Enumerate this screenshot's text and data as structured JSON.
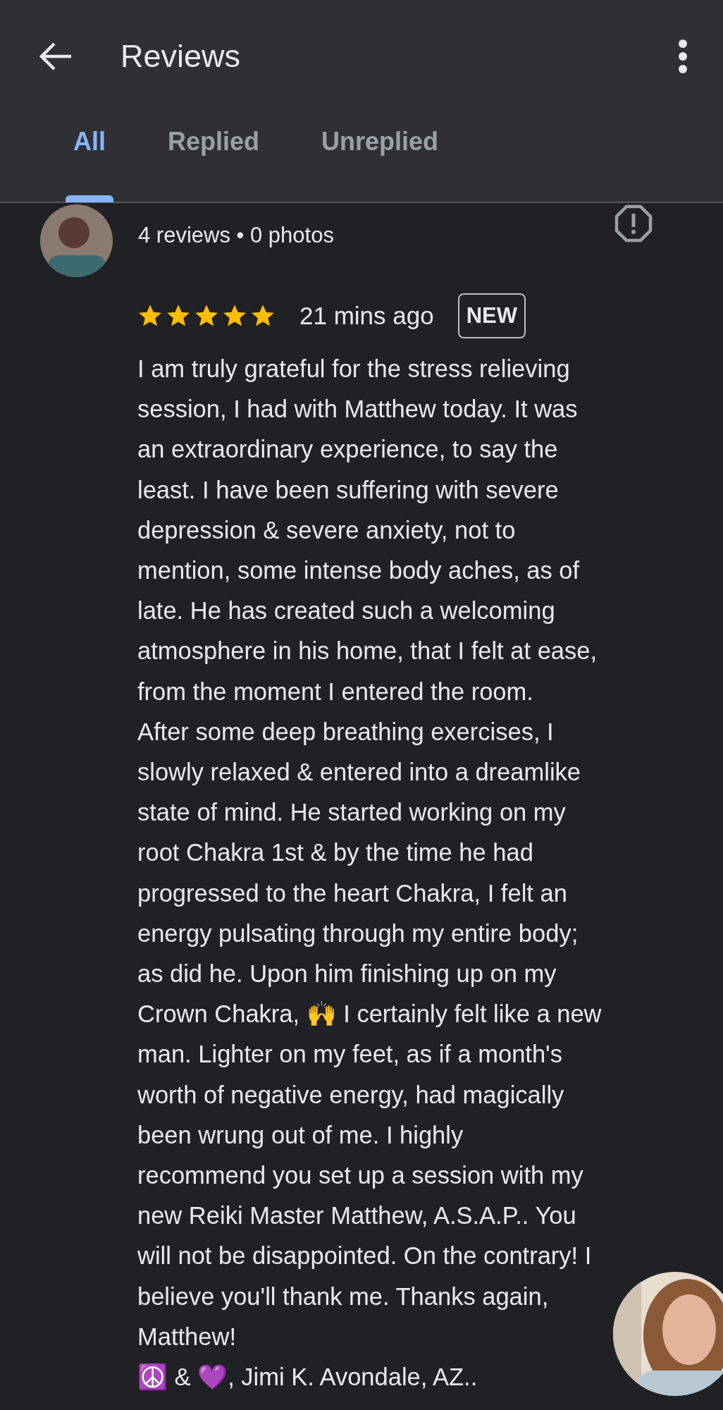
{
  "header": {
    "title": "Reviews"
  },
  "tabs": [
    {
      "label": "All",
      "selected": true
    },
    {
      "label": "Replied",
      "selected": false
    },
    {
      "label": "Unreplied",
      "selected": false
    }
  ],
  "review": {
    "meta": "4 reviews • 0 photos",
    "stars": 5,
    "time": "21 mins ago",
    "badge": "NEW",
    "text": "I am truly grateful for the stress relieving\nsession, I had with Matthew today. It was\nan extraordinary experience, to say the\nleast. I have been suffering with severe\ndepression & severe anxiety, not to\nmention, some intense body aches, as of\nlate. He has created such a welcoming\natmosphere in his home, that I felt at ease,\nfrom the moment I entered the room.\nAfter some deep breathing exercises, I\nslowly relaxed & entered into a dreamlike\nstate of mind. He started working on my\nroot Chakra 1st & by the time he had\nprogressed to the heart Chakra, I felt an\nenergy pulsating through my entire body;\nas did he. Upon him finishing up on my\nCrown Chakra, 🙌 I certainly felt like a new\nman. Lighter on my feet, as if a month's\nworth of negative energy, had magically\nbeen wrung out of me. I highly\nrecommend you set up a session with my\nnew Reiki Master Matthew, A.S.A.P.. You\nwill not be disappointed. On the contrary! I\nbelieve you'll thank me. Thanks again,\nMatthew!\n☮️ & 💜, Jimi K. Avondale, AZ.."
  }
}
